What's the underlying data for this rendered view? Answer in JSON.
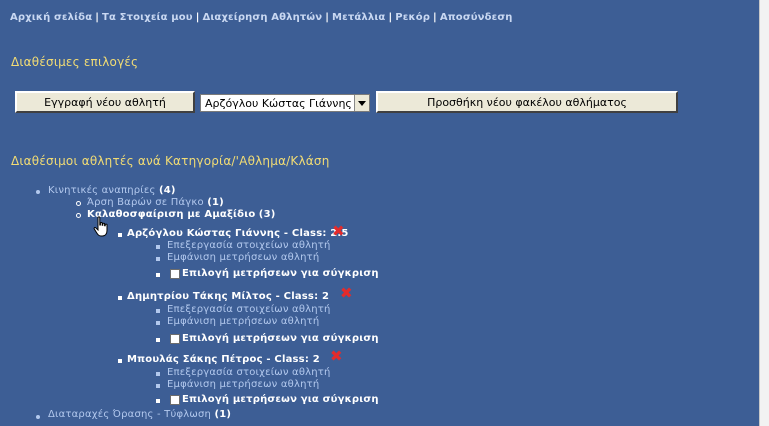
{
  "nav": {
    "items": [
      "Αρχική σελίδα",
      "Τα Στοιχεία μου",
      "Διαχείρηση Αθλητών",
      "Μετάλλια",
      "Ρεκόρ",
      "Αποσύνδεση"
    ],
    "separator": "|"
  },
  "options": {
    "heading": "Διαθέσιμες επιλογές",
    "new_athlete_button": "Εγγραφή νέου αθλητή",
    "athlete_select_value": "Αρζόγλου Κώστας Γιάννης",
    "add_folder_button": "Προσθήκη νέου φακέλου αθλήματος"
  },
  "athletes": {
    "heading": "Διαθέσιμοι αθλητές ανά Κατηγορία/'Αθλημα/Κλάση",
    "categories": [
      {
        "name": "Κινητικές αναπηρίες",
        "count": "(4)"
      },
      {
        "name": "Διαταραχές Όρασης - Τύφλωση",
        "count": "(1)"
      }
    ],
    "sports": [
      {
        "name": "Άρση Βαρών σε Πάγκο",
        "count": "(1)"
      },
      {
        "name": "Καλαθοσφαίριση με Αμαξίδιο",
        "count": "(3)"
      }
    ],
    "entries": [
      {
        "name": "Αρζόγλου Κώστας Γιάννης - Class: 2.5"
      },
      {
        "name": "Δημητρίου Τάκης Μίλτος - Class: 2"
      },
      {
        "name": "Μπουλάς Σάκης Πέτρος - Class: 2"
      }
    ],
    "actions": {
      "edit": "Επεξεργασία στοιχείων αθλητή",
      "show": "Εμφάνιση μετρήσεων αθλητή",
      "compare": "Επιλογή μετρήσεων για σύγκριση"
    },
    "delete_icon": "red-x-icon",
    "colors": {
      "background": "#3d5e95",
      "heading": "#f2dc74",
      "link": "#b3c9ee",
      "delete": "#e42b2b"
    }
  }
}
